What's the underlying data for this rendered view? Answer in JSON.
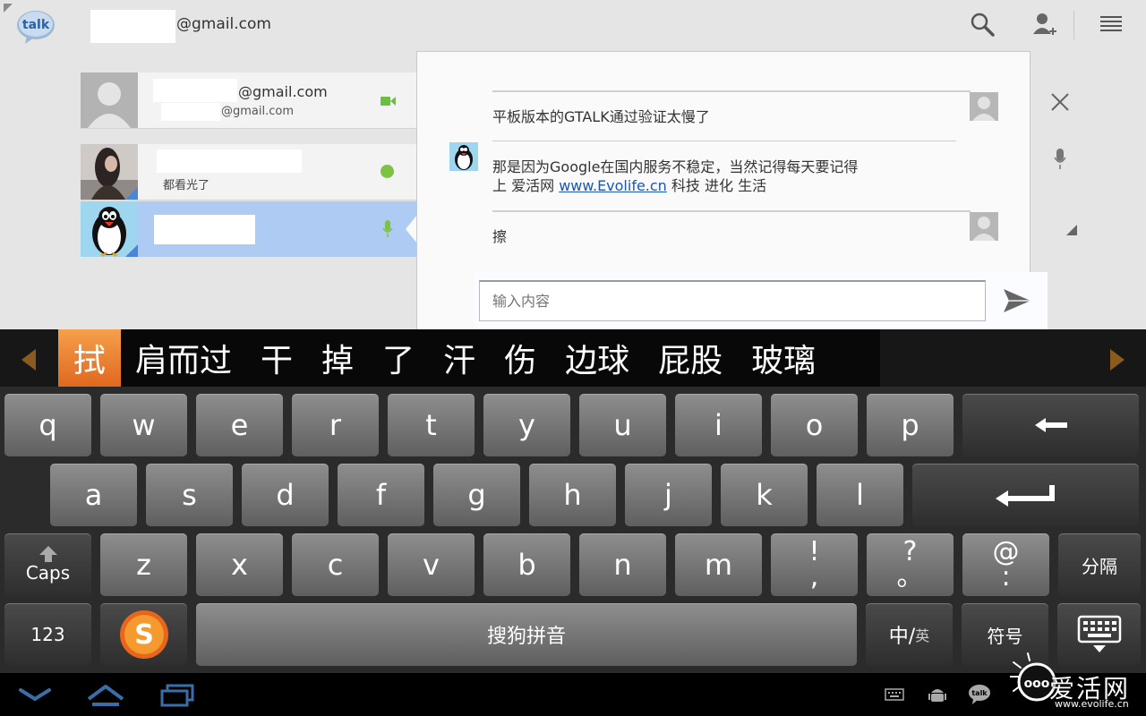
{
  "app": {
    "logo_text": "talk",
    "account_suffix": "@gmail.com"
  },
  "contacts": [
    {
      "title_suffix": "@gmail.com",
      "subtitle_suffix": "@gmail.com",
      "status": "video"
    },
    {
      "status_message": "都看光了",
      "status": "available"
    },
    {
      "status": "voice",
      "selected": true
    }
  ],
  "chat": {
    "messages": [
      {
        "sender": "friend",
        "text": "平板版本的GTALK通过验证太慢了"
      },
      {
        "sender": "me",
        "text_line1": "那是因为Google在国内服务不稳定，当然记得每天要记得",
        "text_line2_prefix": "上 爱活网 ",
        "link": "www.Evolife.cn",
        "text_line2_suffix": " 科技 进化 生活"
      },
      {
        "sender": "friend",
        "text": "擦"
      }
    ],
    "input_placeholder": "输入内容"
  },
  "candidates": [
    "拭",
    "肩而过",
    "干",
    "掉",
    "了",
    "汗",
    "伤",
    "边球",
    "屁股",
    "玻璃"
  ],
  "keyboard": {
    "row1": [
      "q",
      "w",
      "e",
      "r",
      "t",
      "y",
      "u",
      "i",
      "o",
      "p"
    ],
    "row2": [
      "a",
      "s",
      "d",
      "f",
      "g",
      "h",
      "j",
      "k",
      "l"
    ],
    "row3": [
      "z",
      "x",
      "c",
      "v",
      "b",
      "n",
      "m"
    ],
    "caps_label": "Caps",
    "sym_excl": {
      "top": "!",
      "bottom": ","
    },
    "sym_question": {
      "top": "?",
      "bottom": "。"
    },
    "sym_at": {
      "top": "@",
      "bottom": ":"
    },
    "separator_label": "分隔",
    "numbers_label": "123",
    "space_label": "搜狗拼音",
    "lang_main": "中/",
    "lang_sub": "英",
    "symbols_label": "符号"
  },
  "watermark": {
    "text": "爱活网",
    "url": "www.evolife.cn"
  },
  "colors": {
    "selected_row": "#aecbf3",
    "candidate_active": "#e0681f",
    "presence_green": "#7bc341",
    "link_blue": "#1a55b8"
  }
}
